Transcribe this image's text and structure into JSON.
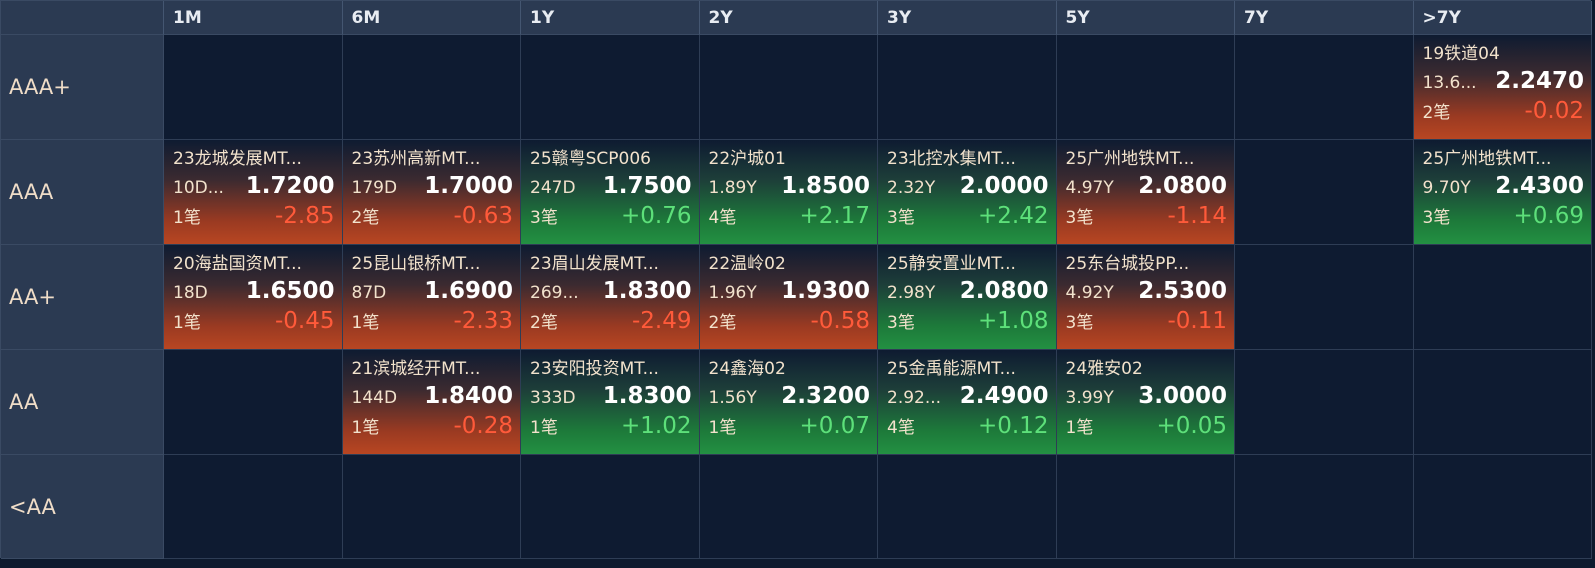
{
  "columns": [
    "1M",
    "6M",
    "1Y",
    "2Y",
    "3Y",
    "5Y",
    "7Y",
    ">7Y"
  ],
  "rows": [
    "AAA+",
    "AAA",
    "AA+",
    "AA",
    "<AA"
  ],
  "colors": {
    "up_change": "#5de07a",
    "down_change": "#ff5a3a",
    "header_bg": "#2b3a52",
    "cell_bg": "#0e1b31"
  },
  "cells": {
    "r0c7": {
      "name": "19铁道04",
      "term": "13.6...",
      "yield": "2.2470",
      "count": "2笔",
      "change": "-0.02",
      "dir": "down"
    },
    "r1c0": {
      "name": "23龙城发展MT...",
      "term": "10D...",
      "yield": "1.7200",
      "count": "1笔",
      "change": "-2.85",
      "dir": "down"
    },
    "r1c1": {
      "name": "23苏州高新MT...",
      "term": "179D",
      "yield": "1.7000",
      "count": "2笔",
      "change": "-0.63",
      "dir": "down"
    },
    "r1c2": {
      "name": "25赣粤SCP006",
      "term": "247D",
      "yield": "1.7500",
      "count": "3笔",
      "change": "+0.76",
      "dir": "up"
    },
    "r1c3": {
      "name": "22沪城01",
      "term": "1.89Y",
      "yield": "1.8500",
      "count": "4笔",
      "change": "+2.17",
      "dir": "up"
    },
    "r1c4": {
      "name": "23北控水集MT...",
      "term": "2.32Y",
      "yield": "2.0000",
      "count": "3笔",
      "change": "+2.42",
      "dir": "up"
    },
    "r1c5": {
      "name": "25广州地铁MT...",
      "term": "4.97Y",
      "yield": "2.0800",
      "count": "3笔",
      "change": "-1.14",
      "dir": "down"
    },
    "r1c7": {
      "name": "25广州地铁MT...",
      "term": "9.70Y",
      "yield": "2.4300",
      "count": "3笔",
      "change": "+0.69",
      "dir": "up"
    },
    "r2c0": {
      "name": "20海盐国资MT...",
      "term": "18D",
      "yield": "1.6500",
      "count": "1笔",
      "change": "-0.45",
      "dir": "down"
    },
    "r2c1": {
      "name": "25昆山银桥MT...",
      "term": "87D",
      "yield": "1.6900",
      "count": "1笔",
      "change": "-2.33",
      "dir": "down"
    },
    "r2c2": {
      "name": "23眉山发展MT...",
      "term": "269...",
      "yield": "1.8300",
      "count": "2笔",
      "change": "-2.49",
      "dir": "down"
    },
    "r2c3": {
      "name": "22温岭02",
      "term": "1.96Y",
      "yield": "1.9300",
      "count": "2笔",
      "change": "-0.58",
      "dir": "down"
    },
    "r2c4": {
      "name": "25静安置业MT...",
      "term": "2.98Y",
      "yield": "2.0800",
      "count": "3笔",
      "change": "+1.08",
      "dir": "up"
    },
    "r2c5": {
      "name": "25东台城投PP...",
      "term": "4.92Y",
      "yield": "2.5300",
      "count": "3笔",
      "change": "-0.11",
      "dir": "down"
    },
    "r3c1": {
      "name": "21滨城经开MT...",
      "term": "144D",
      "yield": "1.8400",
      "count": "1笔",
      "change": "-0.28",
      "dir": "down"
    },
    "r3c2": {
      "name": "23安阳投资MT...",
      "term": "333D",
      "yield": "1.8300",
      "count": "1笔",
      "change": "+1.02",
      "dir": "up"
    },
    "r3c3": {
      "name": "24鑫海02",
      "term": "1.56Y",
      "yield": "2.3200",
      "count": "1笔",
      "change": "+0.07",
      "dir": "up"
    },
    "r3c4": {
      "name": "25金禹能源MT...",
      "term": "2.92...",
      "yield": "2.4900",
      "count": "4笔",
      "change": "+0.12",
      "dir": "up"
    },
    "r3c5": {
      "name": "24雅安02",
      "term": "3.99Y",
      "yield": "3.0000",
      "count": "1笔",
      "change": "+0.05",
      "dir": "up"
    }
  }
}
